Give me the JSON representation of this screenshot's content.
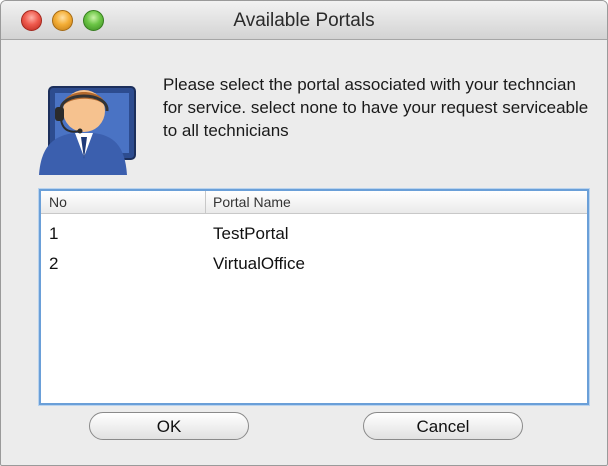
{
  "window": {
    "title": "Available Portals",
    "controls": [
      "close",
      "minimize",
      "zoom"
    ]
  },
  "dialog": {
    "icon": "support-agent-icon",
    "message": "Please select the portal associated with your techncian for service. select none to have your request serviceable to all technicians"
  },
  "table": {
    "columns": {
      "no": "No",
      "portal_name": "Portal Name"
    },
    "rows": [
      {
        "no": "1",
        "portal_name": "TestPortal"
      },
      {
        "no": "2",
        "portal_name": "VirtualOffice"
      }
    ]
  },
  "buttons": {
    "ok": "OK",
    "cancel": "Cancel"
  }
}
